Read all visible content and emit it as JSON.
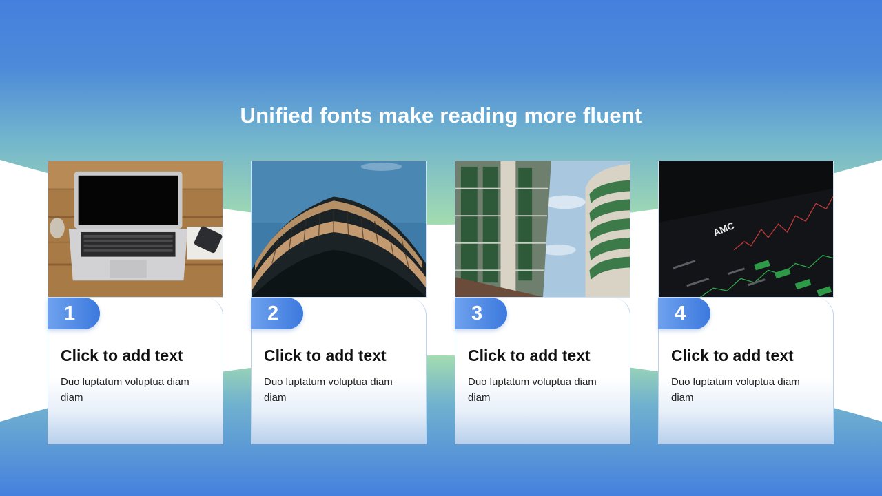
{
  "title": "Unified fonts make reading more fluent",
  "colors": {
    "accent_blue": "#3c79de",
    "band_top": "#4580de",
    "band_mint": "#a3dcb0",
    "text_dark": "#111111",
    "white": "#ffffff"
  },
  "cards": [
    {
      "number": "1",
      "photo": "laptop-on-desk",
      "heading": "Click to add text",
      "description": "Duo luptatum voluptua diam diam"
    },
    {
      "number": "2",
      "photo": "curved-building",
      "heading": "Click to add text",
      "description": "Duo luptatum voluptua diam diam"
    },
    {
      "number": "3",
      "photo": "glass-office-towers",
      "heading": "Click to add text",
      "description": "Duo luptatum voluptua diam diam"
    },
    {
      "number": "4",
      "photo": "stock-chart-screen",
      "heading": "Click to add text",
      "description": "Duo luptatum voluptua diam diam",
      "photo_text": "AMC"
    }
  ]
}
